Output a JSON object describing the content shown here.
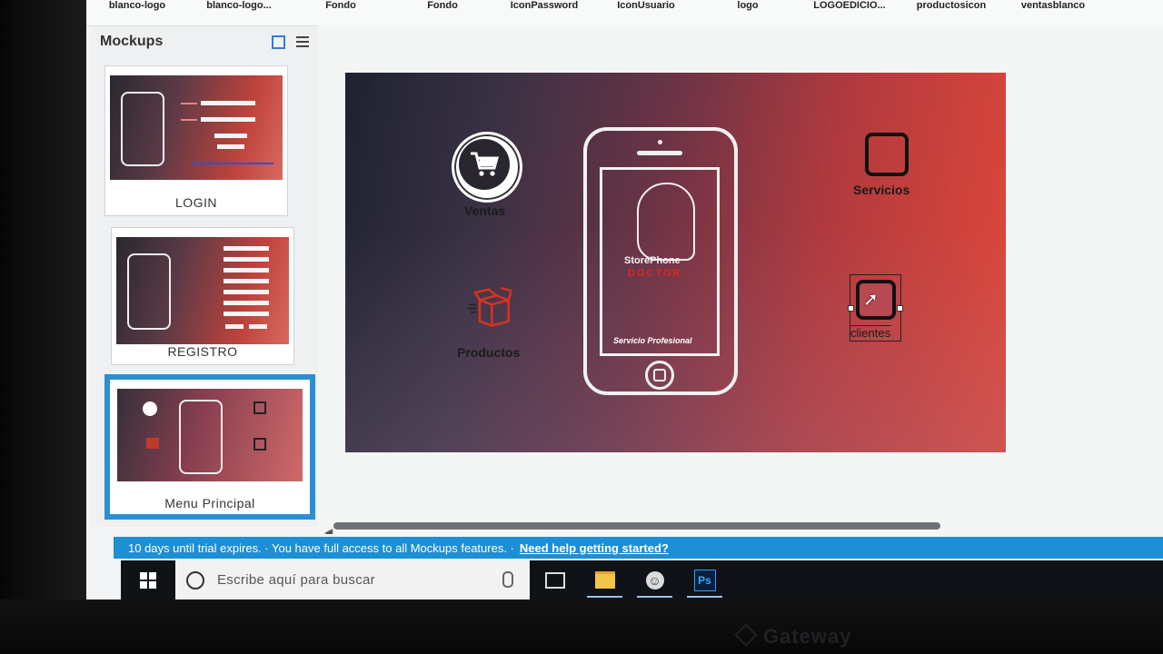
{
  "asset_bar": {
    "items": [
      "blanco-logo",
      "blanco-logo...",
      "Fondo",
      "Fondo",
      "IconPassword",
      "IconUsuario",
      "logo",
      "LOGOEDICIO...",
      "productosicon",
      "ventasblanco"
    ]
  },
  "panel": {
    "title": "Mockups",
    "thumbnails": [
      {
        "label": "LOGIN",
        "selected": false
      },
      {
        "label": "REGISTRO",
        "selected": false
      },
      {
        "label": "Menu Principal",
        "selected": true
      }
    ]
  },
  "mockup": {
    "ventas_label": "Ventas",
    "productos_label": "Productos",
    "servicios_label": "Servicios",
    "clientes_label": "clientes",
    "phone": {
      "brand": "StorePhone",
      "sub": "DOCTOR",
      "footer": "Servicio Profesional"
    },
    "gradient_colors": [
      "#1e2231",
      "#6a3346",
      "#e2483a"
    ]
  },
  "trial_bar": {
    "text": "10 days until trial expires. · You have full access to all Mockups features. ·",
    "link": "Need help getting started?"
  },
  "taskbar": {
    "search_placeholder": "Escribe aquí para buscar",
    "apps": [
      "task-view-icon",
      "file-explorer-icon",
      "emoji-app-icon",
      "photoshop-icon"
    ],
    "photoshop_label": "Ps"
  },
  "monitor": {
    "brand": "Gateway"
  }
}
